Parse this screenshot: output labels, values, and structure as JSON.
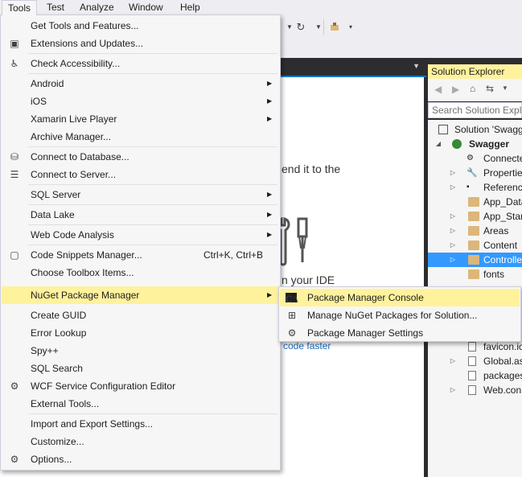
{
  "menubar": {
    "items": [
      "Tools",
      "Test",
      "Analyze",
      "Window",
      "Help"
    ]
  },
  "tools_menu": {
    "items": [
      {
        "label": "Get Tools and Features...",
        "icon": ""
      },
      {
        "label": "Extensions and Updates...",
        "icon": "extensions-icon"
      },
      {
        "label": "Check Accessibility...",
        "icon": "accessibility-icon"
      },
      {
        "label": "Android",
        "submenu": true
      },
      {
        "label": "iOS",
        "submenu": true
      },
      {
        "label": "Xamarin Live Player",
        "submenu": true
      },
      {
        "label": "Archive Manager..."
      },
      {
        "label": "Connect to Database...",
        "icon": "database-icon"
      },
      {
        "label": "Connect to Server...",
        "icon": "server-icon"
      },
      {
        "label": "SQL Server",
        "submenu": true
      },
      {
        "label": "Data Lake",
        "submenu": true
      },
      {
        "label": "Web Code Analysis",
        "submenu": true
      },
      {
        "label": "Code Snippets Manager...",
        "shortcut": "Ctrl+K, Ctrl+B",
        "icon": "snippet-icon"
      },
      {
        "label": "Choose Toolbox Items..."
      },
      {
        "label": "NuGet Package Manager",
        "submenu": true,
        "highlighted": true
      },
      {
        "label": "Create GUID"
      },
      {
        "label": "Error Lookup"
      },
      {
        "label": "Spy++"
      },
      {
        "label": "SQL Search"
      },
      {
        "label": "WCF Service Configuration Editor",
        "icon": "wcf-icon"
      },
      {
        "label": "External Tools..."
      },
      {
        "label": "Import and Export Settings..."
      },
      {
        "label": "Customize..."
      },
      {
        "label": "Options...",
        "icon": "gear-icon"
      }
    ]
  },
  "nuget_submenu": {
    "items": [
      {
        "label": "Package Manager Console",
        "icon": "console-icon",
        "highlighted": true
      },
      {
        "label": "Manage NuGet Packages for Solution...",
        "icon": "packages-icon"
      },
      {
        "label": "Package Manager Settings",
        "icon": "gear-icon"
      }
    ],
    "console_glyph": "C:\\"
  },
  "document": {
    "line1": "end it to the",
    "line2": "n your IDE",
    "link": "code faster"
  },
  "solution_explorer": {
    "title": "Solution Explorer",
    "search_placeholder": "Search Solution Explo",
    "tree": [
      {
        "label": "Solution 'Swagg",
        "indent": 0,
        "expander": "",
        "icon": "solution-icon"
      },
      {
        "label": "Swagger",
        "indent": 1,
        "expander": "open",
        "icon": "web-project-icon",
        "bold": true
      },
      {
        "label": "Connecte",
        "indent": 2,
        "expander": "",
        "icon": "connected-icon"
      },
      {
        "label": "Propertie",
        "indent": 2,
        "expander": "closed",
        "icon": "wrench-icon"
      },
      {
        "label": "Reference",
        "indent": 2,
        "expander": "closed",
        "icon": "reference-icon"
      },
      {
        "label": "App_Data",
        "indent": 2,
        "expander": "",
        "icon": "folder-icon"
      },
      {
        "label": "App_Star",
        "indent": 2,
        "expander": "closed",
        "icon": "folder-icon"
      },
      {
        "label": "Areas",
        "indent": 2,
        "expander": "closed",
        "icon": "folder-icon"
      },
      {
        "label": "Content",
        "indent": 2,
        "expander": "closed",
        "icon": "folder-icon"
      },
      {
        "label": "Controlle",
        "indent": 2,
        "expander": "closed",
        "icon": "folder-icon",
        "selected": true
      },
      {
        "label": "fonts",
        "indent": 2,
        "expander": "",
        "icon": "folder-icon"
      }
    ],
    "tree_bottom": [
      {
        "label": "favicon.ic",
        "expander": "",
        "icon": "file-icon"
      },
      {
        "label": "Global.as",
        "expander": "closed",
        "icon": "file-icon"
      },
      {
        "label": "packages",
        "expander": "",
        "icon": "file-icon"
      },
      {
        "label": "Web.con",
        "expander": "closed",
        "icon": "file-icon"
      }
    ]
  },
  "colors": {
    "highlight": "#fff29d",
    "selection": "#3399ff",
    "accent": "#007acc"
  }
}
